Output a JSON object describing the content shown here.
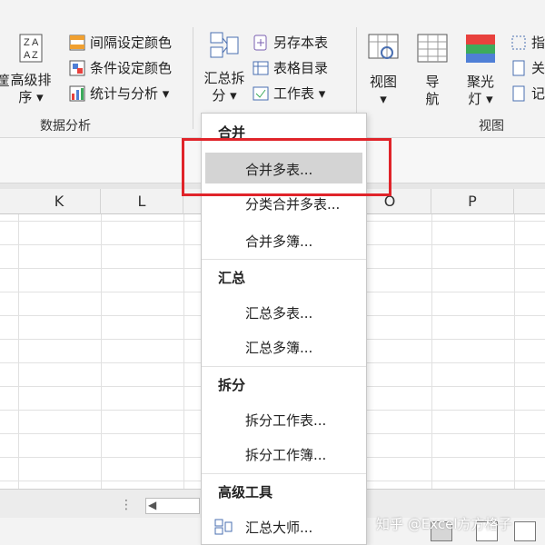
{
  "ribbon": {
    "left_partial_label": "筐",
    "sort": {
      "line1": "高级排",
      "line2": "序 ▾"
    },
    "interval_color": "间隔设定颜色",
    "cond_color": "条件设定颜色",
    "stats": "统计与分析 ▾",
    "data_analysis_group": "数据分析",
    "summary_split": {
      "line1": "汇总拆",
      "line2": "分 ▾"
    },
    "save_as": "另存本表",
    "table_dir": "表格目录",
    "worksheet": "工作表 ▾",
    "view_btn": {
      "line1": "视图",
      "line2": "▾"
    },
    "nav_btn": {
      "line1": "导",
      "line2": "航"
    },
    "spotlight_btn": {
      "line1": "聚光",
      "line2": "灯 ▾"
    },
    "view_group": "视图",
    "right_partial_1": "指",
    "right_partial_2": "关",
    "right_partial_3": "记",
    "colors": {
      "spotlight_red": "#e8413d",
      "spotlight_green": "#3dab5c",
      "spotlight_blue": "#4f7fd6"
    }
  },
  "columns": [
    "K",
    "L",
    "O",
    "P"
  ],
  "menu": {
    "sec_merge": "合并",
    "merge_multi": "合并多表...",
    "classify_merge": "分类合并多表...",
    "merge_books": "合并多簿...",
    "sec_summary": "汇总",
    "summary_multi": "汇总多表...",
    "summary_books": "汇总多簿...",
    "sec_split": "拆分",
    "split_sheet": "拆分工作表...",
    "split_book": "拆分工作簿...",
    "sec_advanced": "高级工具",
    "summary_master": "汇总大师..."
  },
  "watermark": "知乎 @Excel方方格子",
  "bottom": {
    "dots": "⋮",
    "scroll_left": "◀"
  }
}
